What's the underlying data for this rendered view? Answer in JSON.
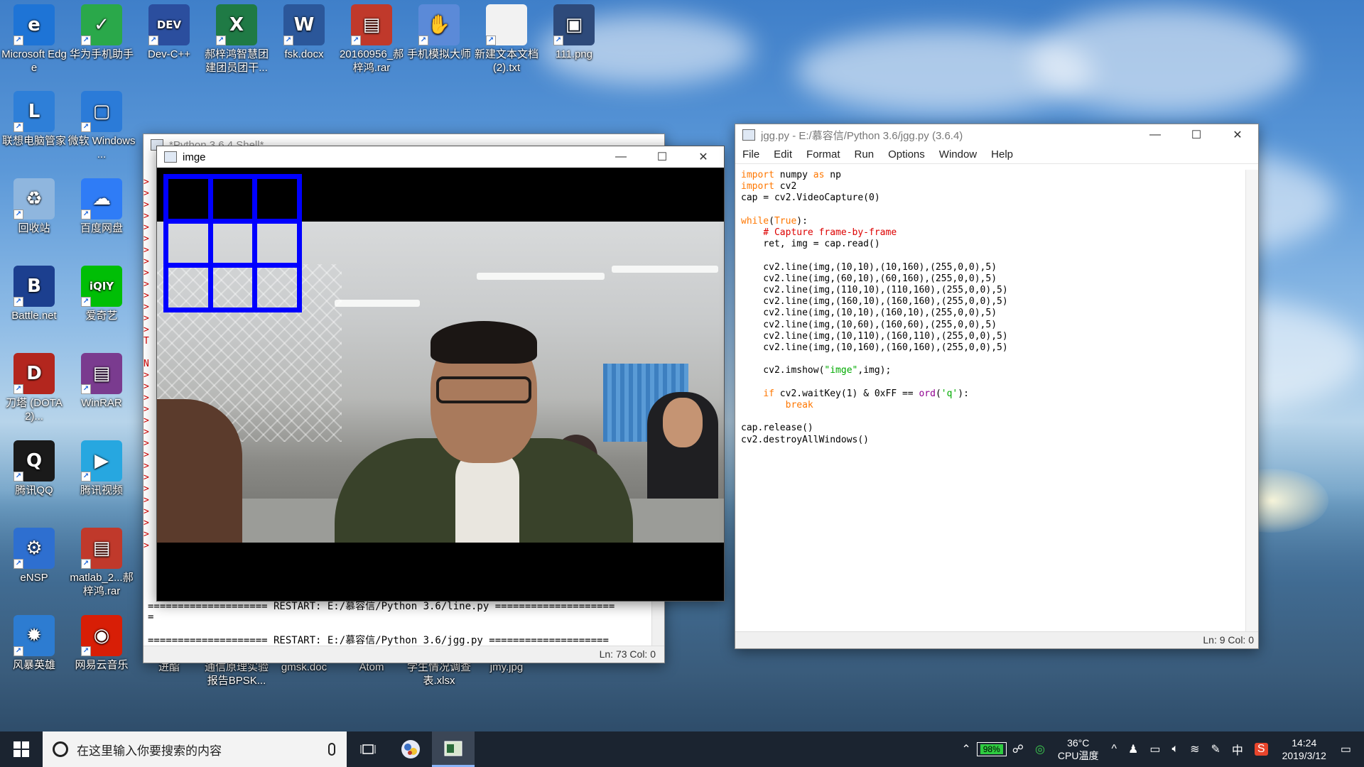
{
  "desktop": {
    "icons": [
      {
        "label": "Microsoft Edge",
        "glyph": "e",
        "color": "#1e74d6"
      },
      {
        "label": "华为手机助手",
        "glyph": "✓",
        "color": "#2aa84a"
      },
      {
        "label": "Dev-C++",
        "glyph": "DEV",
        "color": "#2b4e9e"
      },
      {
        "label": "郝梓鸿智慧团建团员团干...",
        "glyph": "X",
        "color": "#1f7a45"
      },
      {
        "label": "fsk.docx",
        "glyph": "W",
        "color": "#2b579a"
      },
      {
        "label": "20160956_郝梓鸿.rar",
        "glyph": "▤",
        "color": "#c0392b"
      },
      {
        "label": "手机模拟大师",
        "glyph": "✋",
        "color": "#5b8ad8"
      },
      {
        "label": "新建文本文档 (2).txt",
        "glyph": "",
        "color": "#f2f2f2"
      },
      {
        "label": "111.png",
        "glyph": "▣",
        "color": "#2e4a7a"
      },
      {
        "label": "联想电脑管家",
        "glyph": "L",
        "color": "#2e7fd8"
      },
      {
        "label": "微软 Windows ...",
        "glyph": "▢",
        "color": "#2b7bd8"
      },
      {
        "label": "回收站",
        "glyph": "♻",
        "color": "#8fb6de"
      },
      {
        "label": "百度网盘",
        "glyph": "☁",
        "color": "#2f7cf6"
      },
      {
        "label": "Battle.net",
        "glyph": "B",
        "color": "#1c3f8f"
      },
      {
        "label": "爱奇艺",
        "glyph": "iQIY",
        "color": "#00be06"
      },
      {
        "label": "刀塔 (DOTA2)...",
        "glyph": "D",
        "color": "#b3261e"
      },
      {
        "label": "WinRAR",
        "glyph": "▤",
        "color": "#7a3b8f"
      },
      {
        "label": "腾讯QQ",
        "glyph": "Q",
        "color": "#1a1a1a"
      },
      {
        "label": "腾讯视频",
        "glyph": "▶",
        "color": "#27a7e0"
      },
      {
        "label": "eNSP",
        "glyph": "⚙",
        "color": "#2e6fd0"
      },
      {
        "label": "matlab_2...郝梓鸿.rar",
        "glyph": "▤",
        "color": "#c0392b"
      },
      {
        "label": "风暴英雄",
        "glyph": "✹",
        "color": "#2d7cd1"
      },
      {
        "label": "网易云音乐",
        "glyph": "◉",
        "color": "#d81e06"
      }
    ],
    "partial_labels": [
      "进酯",
      "通信原理实验报告BPSK...",
      "gmsk.doc",
      "Atom",
      "学生情况调查表.xlsx",
      "jmy.jpg"
    ]
  },
  "shell_window": {
    "title": "*Python 3.6.4 Shell*",
    "restart_line_1": "==================== RESTART: E:/慕容信/Python 3.6/line.py ====================",
    "restart_eq": "=",
    "restart_line_2": "==================== RESTART: E:/慕容信/Python 3.6/jgg.py ====================",
    "status": "Ln: 73   Col: 0"
  },
  "image_window": {
    "title": "imge",
    "minimize": "—",
    "maximize": "☐",
    "close": "✕",
    "grid_color": "#0000ff"
  },
  "editor_window": {
    "title": "jgg.py - E:/慕容信/Python 3.6/jgg.py (3.6.4)",
    "minimize": "—",
    "maximize": "☐",
    "close": "✕",
    "menu": [
      "File",
      "Edit",
      "Format",
      "Run",
      "Options",
      "Window",
      "Help"
    ],
    "code_lines": [
      "import numpy as np",
      "import cv2",
      "cap = cv2.VideoCapture(0)",
      "",
      "while(True):",
      "    # Capture frame-by-frame",
      "    ret, img = cap.read()",
      "",
      "    cv2.line(img,(10,10),(10,160),(255,0,0),5)",
      "    cv2.line(img,(60,10),(60,160),(255,0,0),5)",
      "    cv2.line(img,(110,10),(110,160),(255,0,0),5)",
      "    cv2.line(img,(160,10),(160,160),(255,0,0),5)",
      "    cv2.line(img,(10,10),(160,10),(255,0,0),5)",
      "    cv2.line(img,(10,60),(160,60),(255,0,0),5)",
      "    cv2.line(img,(10,110),(160,110),(255,0,0),5)",
      "    cv2.line(img,(10,160),(160,160),(255,0,0),5)",
      "",
      "    cv2.imshow(\"imge\",img);",
      "",
      "    if cv2.waitKey(1) & 0xFF == ord('q'):",
      "        break",
      "",
      "cap.release()",
      "cv2.destroyAllWindows()"
    ],
    "status": "Ln: 9   Col: 0"
  },
  "taskbar": {
    "search_placeholder": "在这里输入你要搜索的内容",
    "battery": "98%",
    "cpu_temp": "36°C",
    "cpu_label": "CPU温度",
    "ime": "中",
    "time": "14:24",
    "date": "2019/3/12"
  }
}
